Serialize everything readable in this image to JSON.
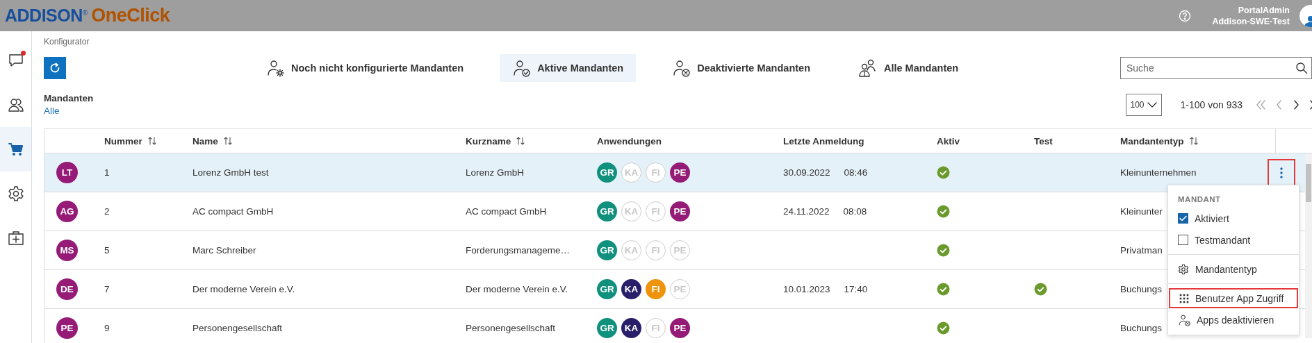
{
  "header": {
    "logo_primary": "ADDISON",
    "logo_mark": "®",
    "logo_secondary": "OneClick",
    "user_name": "PortalAdmin",
    "tenant": "Addison-SWE-Test"
  },
  "sidebar": {
    "items": [
      {
        "selected": false,
        "notification": true
      },
      {
        "selected": false,
        "notification": false
      },
      {
        "selected": true,
        "notification": false
      },
      {
        "selected": false,
        "notification": false
      },
      {
        "selected": false,
        "notification": false
      }
    ]
  },
  "breadcrumb": "Konfigurator",
  "tabs": [
    {
      "label": "Noch nicht konfigurierte Mandanten",
      "selected": false
    },
    {
      "label": "Aktive Mandanten",
      "selected": true
    },
    {
      "label": "Deaktivierte Mandanten",
      "selected": false
    },
    {
      "label": "Alle Mandanten",
      "selected": false
    }
  ],
  "search": {
    "placeholder": "Suche"
  },
  "filter": {
    "title": "Mandanten",
    "value": "Alle"
  },
  "pagination": {
    "page_size": "100",
    "range": "1-100 von 933"
  },
  "table": {
    "columns": [
      {
        "label": "Nummer",
        "sortable": true
      },
      {
        "label": "Name",
        "sortable": true
      },
      {
        "label": "Kurzname",
        "sortable": true
      },
      {
        "label": "Anwendungen",
        "sortable": false
      },
      {
        "label": "Letzte Anmeldung",
        "sortable": false
      },
      {
        "label": "Aktiv",
        "sortable": false
      },
      {
        "label": "Test",
        "sortable": false
      },
      {
        "label": "Mandantentyp",
        "sortable": true
      }
    ],
    "rows": [
      {
        "selected": true,
        "initials": "LT",
        "number": "1",
        "name": "Lorenz GmbH test",
        "short_name": "Lorenz GmbH",
        "apps": [
          {
            "label": "GR",
            "active": true,
            "color": "#10917d"
          },
          {
            "label": "KA",
            "active": false
          },
          {
            "label": "FI",
            "active": false
          },
          {
            "label": "PE",
            "active": true,
            "color": "#941b76"
          }
        ],
        "last_login_date": "30.09.2022",
        "last_login_time": "08:46",
        "active": true,
        "test": false,
        "type": "Kleinunternehmen",
        "actions": {
          "highlighted": true
        }
      },
      {
        "selected": false,
        "initials": "AG",
        "number": "2",
        "name": "AC compact GmbH",
        "short_name": "AC compact GmbH",
        "apps": [
          {
            "label": "GR",
            "active": true,
            "color": "#10917d"
          },
          {
            "label": "KA",
            "active": false
          },
          {
            "label": "FI",
            "active": false
          },
          {
            "label": "PE",
            "active": true,
            "color": "#941b76"
          }
        ],
        "last_login_date": "24.11.2022",
        "last_login_time": "08:08",
        "active": true,
        "test": false,
        "type": "Kleinunter"
      },
      {
        "selected": false,
        "initials": "MS",
        "number": "5",
        "name": "Marc Schreiber",
        "short_name": "Forderungsmanageme…",
        "apps": [
          {
            "label": "GR",
            "active": true,
            "color": "#10917d"
          },
          {
            "label": "KA",
            "active": false
          },
          {
            "label": "FI",
            "active": false
          },
          {
            "label": "PE",
            "active": false
          }
        ],
        "active": true,
        "test": false,
        "type": "Privatman"
      },
      {
        "selected": false,
        "initials": "DE",
        "number": "7",
        "name": "Der moderne Verein e.V.",
        "short_name": "Der moderne Verein e.V.",
        "apps": [
          {
            "label": "GR",
            "active": true,
            "color": "#10917d"
          },
          {
            "label": "KA",
            "active": true,
            "color": "#291e69"
          },
          {
            "label": "FI",
            "active": true,
            "color": "#ef930d"
          },
          {
            "label": "PE",
            "active": false
          }
        ],
        "last_login_date": "10.01.2023",
        "last_login_time": "17:40",
        "active": true,
        "test": true,
        "type": "Buchungs"
      },
      {
        "selected": false,
        "initials": "PE",
        "number": "9",
        "name": "Personengesellschaft",
        "short_name": "Personengesellschaft",
        "apps": [
          {
            "label": "GR",
            "active": true,
            "color": "#10917d"
          },
          {
            "label": "KA",
            "active": true,
            "color": "#291e69"
          },
          {
            "label": "FI",
            "active": false
          },
          {
            "label": "PE",
            "active": true,
            "color": "#941b76"
          }
        ],
        "active": true,
        "test": false,
        "type": "Buchungs"
      }
    ]
  },
  "context_menu": {
    "title": "MANDANT",
    "items": [
      {
        "kind": "checkbox",
        "label": "Aktiviert",
        "checked": true
      },
      {
        "kind": "checkbox",
        "label": "Testmandant",
        "checked": false
      },
      {
        "kind": "divider"
      },
      {
        "kind": "action",
        "label": "Mandantentyp",
        "highlighted": false
      },
      {
        "kind": "divider"
      },
      {
        "kind": "action",
        "label": "Benutzer App Zugriff",
        "highlighted": true
      },
      {
        "kind": "action",
        "label": "Apps deaktivieren",
        "highlighted": false
      }
    ]
  }
}
